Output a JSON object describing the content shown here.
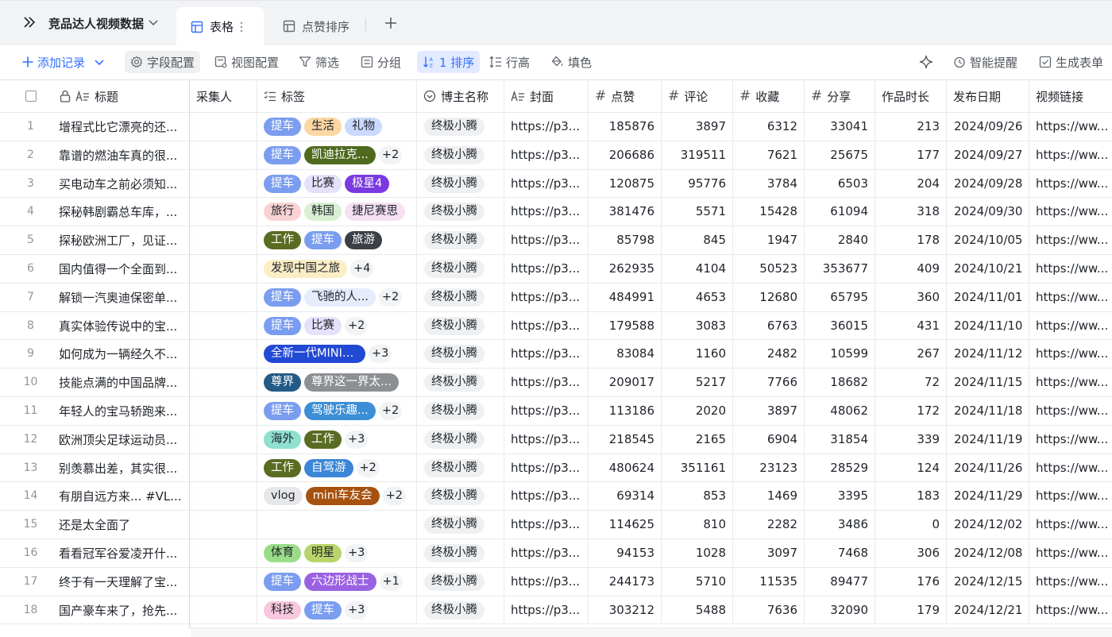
{
  "tabbar": {
    "base_title": "竞品达人视频数据",
    "tab_table": "表格",
    "tab_likes": "点赞排序"
  },
  "toolbar": {
    "add_record": "添加记录",
    "field_config": "字段配置",
    "view_config": "视图配置",
    "filter": "筛选",
    "group": "分组",
    "sort": "1 排序",
    "row_height": "行高",
    "fill": "填色",
    "smart_remind": "智能提醒",
    "generate_form": "生成表单"
  },
  "columns": {
    "title": "标题",
    "collector": "采集人",
    "tags": "标签",
    "blogger": "博主名称",
    "cover": "封面",
    "likes": "点赞",
    "comments": "评论",
    "favorites": "收藏",
    "shares": "分享",
    "duration": "作品时长",
    "publish_date": "发布日期",
    "video_link": "视频链接"
  },
  "tag_colors": {
    "提车": {
      "bg": "#7b9df0",
      "fg": "#ffffff"
    },
    "生活": {
      "bg": "#fbd7a4",
      "fg": "#1f2329"
    },
    "礼物": {
      "bg": "#c9dafc",
      "fg": "#1f2329"
    },
    "凯迪拉克...": {
      "bg": "#4f6a1f",
      "fg": "#ffffff"
    },
    "比赛": {
      "bg": "#e5e1fb",
      "fg": "#1f2329"
    },
    "极星4": {
      "bg": "#7a3ae0",
      "fg": "#ffffff"
    },
    "旅行": {
      "bg": "#f9d3d4",
      "fg": "#1f2329"
    },
    "韩国": {
      "bg": "#d7f1d2",
      "fg": "#1f2329"
    },
    "捷尼赛思": {
      "bg": "#f6e1f3",
      "fg": "#1f2329"
    },
    "工作": {
      "bg": "#596c22",
      "fg": "#ffffff"
    },
    "旅游": {
      "bg": "#3b3f46",
      "fg": "#ffffff"
    },
    "发现中国之旅": {
      "bg": "#fbeec6",
      "fg": "#1f2329"
    },
    "飞驰的人...": {
      "bg": "#e6ecfb",
      "fg": "#1f2329"
    },
    "全新一代MINICO...": {
      "bg": "#2249d3",
      "fg": "#ffffff"
    },
    "尊界": {
      "bg": "#245b86",
      "fg": "#ffffff"
    },
    "尊界这一界太...": {
      "bg": "#8c8f94",
      "fg": "#ffffff"
    },
    "驾驶乐趣...": {
      "bg": "#3c8fd6",
      "fg": "#ffffff"
    },
    "海外": {
      "bg": "#8fe0cf",
      "fg": "#1f2329"
    },
    "自驾游": {
      "bg": "#3b86d6",
      "fg": "#ffffff"
    },
    "vlog": {
      "bg": "#e6e7e9",
      "fg": "#1f2329"
    },
    "mini车友会": {
      "bg": "#a6510e",
      "fg": "#ffffff"
    },
    "体育": {
      "bg": "#9bdc8a",
      "fg": "#1f2329"
    },
    "明星": {
      "bg": "#b9d46a",
      "fg": "#1f2329"
    },
    "六边形战士": {
      "bg": "#9a62e0",
      "fg": "#ffffff"
    },
    "科技": {
      "bg": "#f8c8de",
      "fg": "#1f2329"
    }
  },
  "rows": [
    {
      "n": "1",
      "title": "增程式比它漂亮的还...",
      "tags": [
        "提车",
        "生活",
        "礼物"
      ],
      "more": "",
      "blogger": "终极小腾",
      "cover": "https://p3...",
      "likes": "185876",
      "comments": "3897",
      "favorites": "6312",
      "shares": "33041",
      "duration": "213",
      "date": "2024/09/26",
      "link": "https://ww..."
    },
    {
      "n": "2",
      "title": "靠谱的燃油车真的很...",
      "tags": [
        "提车",
        "凯迪拉克..."
      ],
      "more": "+2",
      "blogger": "终极小腾",
      "cover": "https://p3...",
      "likes": "206686",
      "comments": "319511",
      "favorites": "7621",
      "shares": "25675",
      "duration": "177",
      "date": "2024/09/27",
      "link": "https://ww..."
    },
    {
      "n": "3",
      "title": "买电动车之前必须知...",
      "tags": [
        "提车",
        "比赛",
        "极星4"
      ],
      "more": "",
      "blogger": "终极小腾",
      "cover": "https://p3...",
      "likes": "120875",
      "comments": "95776",
      "favorites": "3784",
      "shares": "6503",
      "duration": "204",
      "date": "2024/09/28",
      "link": "https://ww..."
    },
    {
      "n": "4",
      "title": "探秘韩剧霸总车库，...",
      "tags": [
        "旅行",
        "韩国",
        "捷尼赛思"
      ],
      "more": "",
      "blogger": "终极小腾",
      "cover": "https://p3...",
      "likes": "381476",
      "comments": "5571",
      "favorites": "15428",
      "shares": "61094",
      "duration": "318",
      "date": "2024/09/30",
      "link": "https://ww..."
    },
    {
      "n": "5",
      "title": "探秘欧洲工厂，见证...",
      "tags": [
        "工作",
        "提车",
        "旅游"
      ],
      "more": "",
      "blogger": "终极小腾",
      "cover": "https://p3...",
      "likes": "85798",
      "comments": "845",
      "favorites": "1947",
      "shares": "2840",
      "duration": "178",
      "date": "2024/10/05",
      "link": "https://ww..."
    },
    {
      "n": "6",
      "title": "国内值得一个全面到...",
      "tags": [
        "发现中国之旅"
      ],
      "more": "+4",
      "blogger": "终极小腾",
      "cover": "https://p3...",
      "likes": "262935",
      "comments": "4104",
      "favorites": "50523",
      "shares": "353677",
      "duration": "409",
      "date": "2024/10/21",
      "link": "https://ww..."
    },
    {
      "n": "7",
      "title": "解锁一汽奥迪保密单...",
      "tags": [
        "提车",
        "飞驰的人..."
      ],
      "more": "+2",
      "blogger": "终极小腾",
      "cover": "https://p3...",
      "likes": "484991",
      "comments": "4653",
      "favorites": "12680",
      "shares": "65795",
      "duration": "360",
      "date": "2024/11/01",
      "link": "https://ww..."
    },
    {
      "n": "8",
      "title": "真实体验传说中的宝...",
      "tags": [
        "提车",
        "比赛"
      ],
      "more": "+2",
      "blogger": "终极小腾",
      "cover": "https://p3...",
      "likes": "179588",
      "comments": "3083",
      "favorites": "6763",
      "shares": "36015",
      "duration": "431",
      "date": "2024/11/10",
      "link": "https://ww..."
    },
    {
      "n": "9",
      "title": "如何成为一辆经久不...",
      "tags": [
        "全新一代MINICO..."
      ],
      "more": "+3",
      "blogger": "终极小腾",
      "cover": "https://p3...",
      "likes": "83084",
      "comments": "1160",
      "favorites": "2482",
      "shares": "10599",
      "duration": "267",
      "date": "2024/11/12",
      "link": "https://ww..."
    },
    {
      "n": "10",
      "title": "技能点满的中国品牌...",
      "tags": [
        "尊界",
        "尊界这一界太..."
      ],
      "more": "",
      "blogger": "终极小腾",
      "cover": "https://p3...",
      "likes": "209017",
      "comments": "5217",
      "favorites": "7766",
      "shares": "18682",
      "duration": "72",
      "date": "2024/11/15",
      "link": "https://ww..."
    },
    {
      "n": "11",
      "title": "年轻人的宝马轿跑来...",
      "tags": [
        "提车",
        "驾驶乐趣..."
      ],
      "more": "+2",
      "blogger": "终极小腾",
      "cover": "https://p3...",
      "likes": "113186",
      "comments": "2020",
      "favorites": "3897",
      "shares": "48062",
      "duration": "172",
      "date": "2024/11/18",
      "link": "https://ww..."
    },
    {
      "n": "12",
      "title": "欧洲顶尖足球运动员...",
      "tags": [
        "海外",
        "工作"
      ],
      "more": "+3",
      "blogger": "终极小腾",
      "cover": "https://p3...",
      "likes": "218545",
      "comments": "2165",
      "favorites": "6904",
      "shares": "31854",
      "duration": "339",
      "date": "2024/11/19",
      "link": "https://ww..."
    },
    {
      "n": "13",
      "title": "别羡慕出差，其实很...",
      "tags": [
        "工作",
        "自驾游"
      ],
      "more": "+2",
      "blogger": "终极小腾",
      "cover": "https://p3...",
      "likes": "480624",
      "comments": "351161",
      "favorites": "23123",
      "shares": "28529",
      "duration": "124",
      "date": "2024/11/26",
      "link": "https://ww..."
    },
    {
      "n": "14",
      "title": "有朋自远方来... #VL...",
      "tags": [
        "vlog",
        "mini车友会"
      ],
      "more": "+2",
      "blogger": "终极小腾",
      "cover": "https://p3...",
      "likes": "69314",
      "comments": "853",
      "favorites": "1469",
      "shares": "3395",
      "duration": "183",
      "date": "2024/11/29",
      "link": "https://ww..."
    },
    {
      "n": "15",
      "title": "还是太全面了",
      "tags": [],
      "more": "",
      "blogger": "终极小腾",
      "cover": "https://p3...",
      "likes": "114625",
      "comments": "810",
      "favorites": "2282",
      "shares": "3486",
      "duration": "0",
      "date": "2024/12/02",
      "link": "https://ww..."
    },
    {
      "n": "16",
      "title": "看看冠军谷爱凌开什...",
      "tags": [
        "体育",
        "明星"
      ],
      "more": "+3",
      "blogger": "终极小腾",
      "cover": "https://p3...",
      "likes": "94153",
      "comments": "1028",
      "favorites": "3097",
      "shares": "7468",
      "duration": "306",
      "date": "2024/12/08",
      "link": "https://ww..."
    },
    {
      "n": "17",
      "title": "终于有一天理解了宝...",
      "tags": [
        "提车",
        "六边形战士"
      ],
      "more": "+1",
      "blogger": "终极小腾",
      "cover": "https://p3...",
      "likes": "244173",
      "comments": "5710",
      "favorites": "11535",
      "shares": "89477",
      "duration": "176",
      "date": "2024/12/15",
      "link": "https://ww..."
    },
    {
      "n": "18",
      "title": "国产豪车来了，抢先...",
      "tags": [
        "科技",
        "提车"
      ],
      "more": "+3",
      "blogger": "终极小腾",
      "cover": "https://p3...",
      "likes": "303212",
      "comments": "5488",
      "favorites": "7636",
      "shares": "32090",
      "duration": "179",
      "date": "2024/12/21",
      "link": "https://ww..."
    }
  ]
}
